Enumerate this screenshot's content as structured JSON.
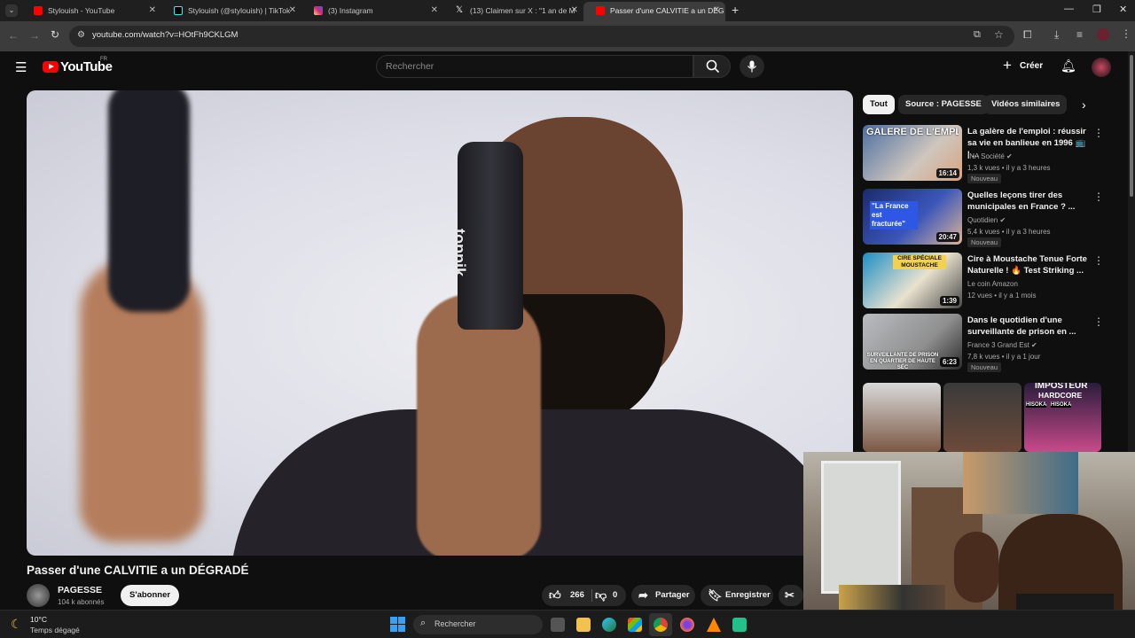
{
  "browser": {
    "tabs": [
      {
        "title": "Stylouish - YouTube",
        "color": "#ff0000"
      },
      {
        "title": "Stylouish (@stylouish) | TikTok",
        "color": "#000000"
      },
      {
        "title": "(3) Instagram",
        "color": "#d6249f"
      },
      {
        "title": "(13) Claimen sur X : \"1 an de M",
        "color": "#000000"
      },
      {
        "title": "Passer d'une CALVITIE a un DÉG",
        "color": "#ff0000"
      }
    ],
    "new_tab": "+",
    "url": "youtube.com/watch?v=HOtFh9CKLGM"
  },
  "youtube": {
    "logo_text": "YouTube",
    "region": "FR",
    "search_placeholder": "Rechercher",
    "create_label": "Créer"
  },
  "video": {
    "title": "Passer d'une CALVITIE a un DÉGRADÉ",
    "channel": "PAGESSE",
    "subscribers": "104 k abonnés",
    "subscribe_label": "S'abonner",
    "likes": "266",
    "dislikes": "0",
    "share_label": "Partager",
    "save_label": "Enregistrer",
    "product_text": "toppik"
  },
  "sidebar": {
    "chips": [
      "Tout",
      "Source : PAGESSE",
      "Vidéos similaires"
    ],
    "recommendations": [
      {
        "title": "La galère de l'emploi : réussir sa vie en banlieue en 1996 📺 | ...",
        "channel": "INA Société",
        "meta": "1,3 k vues • il y a 3 heures",
        "badge": "Nouveau",
        "duration": "16:14",
        "thumb_text": "GALÈRE DE L'EMPLOI",
        "verified": true
      },
      {
        "title": "Quelles leçons tirer des municipales en France ? ...",
        "channel": "Quotidien",
        "meta": "5,4 k vues • il y a 3 heures",
        "badge": "Nouveau",
        "duration": "20:47",
        "thumb_text": "\"La France est fracturée\"",
        "verified": true
      },
      {
        "title": "Cire à Moustache Tenue Forte Naturelle ! 🔥 Test Striking ...",
        "channel": "Le coin Amazon",
        "meta": "12 vues • il y a 1 mois",
        "badge": "",
        "duration": "1:39",
        "thumb_text": "CIRE SPÉCIALE MOUSTACHE",
        "verified": false
      },
      {
        "title": "Dans le quotidien d'une surveillante de prison en ...",
        "channel": "France 3 Grand Est",
        "meta": "7,8 k vues • il y a 1 jour",
        "badge": "Nouveau",
        "duration": "6:23",
        "thumb_text": "SURVEILLANTE DE PRISON EN QUARTIER DE HAUTE SÉC",
        "verified": true
      }
    ],
    "shorts_text": [
      "IMPOSTEUR",
      "HARDCORE",
      "HISOKA",
      "HISOKA"
    ]
  },
  "taskbar": {
    "temp": "10°C",
    "weather": "Temps dégagé",
    "search_label": "Rechercher"
  }
}
